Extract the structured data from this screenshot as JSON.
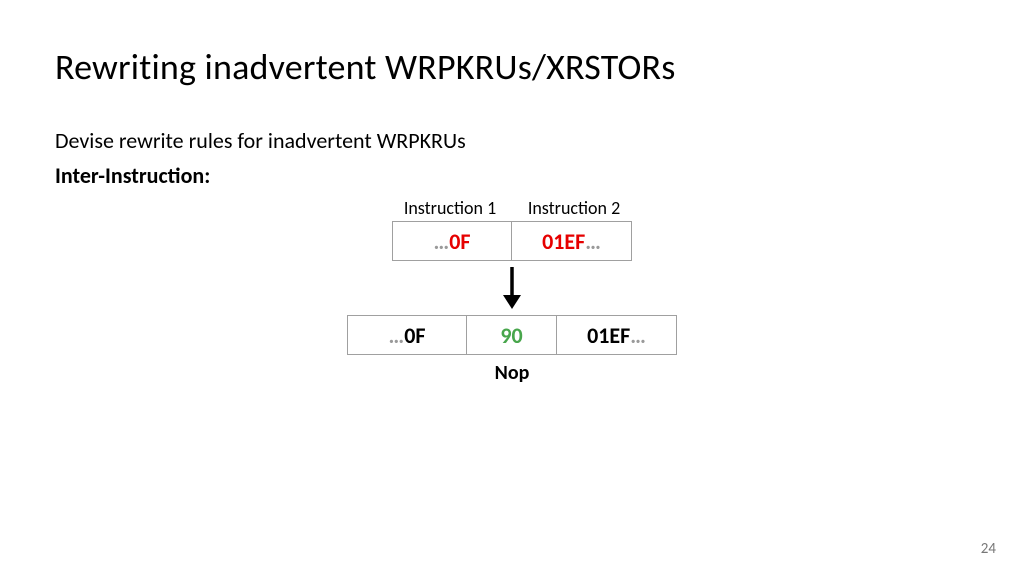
{
  "title": "Rewriting inadvertent WRPKRUs/XRSTORs",
  "subtitle": "Devise rewrite rules for inadvertent WRPKRUs",
  "bold_label": "Inter-Instruction:",
  "headers": {
    "h1": "Instruction 1",
    "h2": "Instruction 2"
  },
  "row1": {
    "cell1_prefix": "…",
    "cell1_value": "0F",
    "cell2_value": "01EF",
    "cell2_suffix": "…"
  },
  "row2": {
    "cell1_prefix": "…",
    "cell1_value": "0F",
    "cell2_value": "90",
    "cell3_value": "01EF",
    "cell3_suffix": "…"
  },
  "nop_label": "Nop",
  "page_number": "24"
}
